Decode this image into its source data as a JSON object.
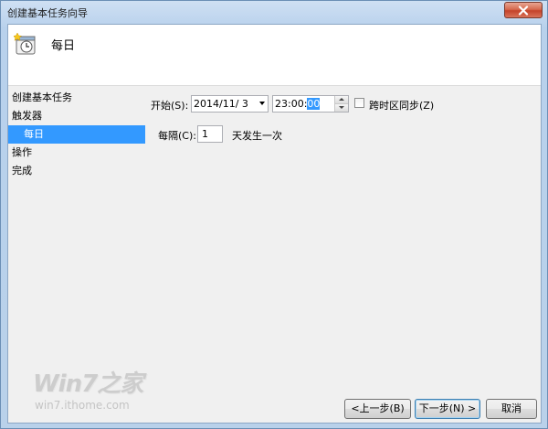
{
  "window": {
    "title": "创建基本任务向导"
  },
  "header": {
    "title": "每日",
    "icon": "clock-icon"
  },
  "steps": [
    {
      "label": "创建基本任务"
    },
    {
      "label": "触发器"
    },
    {
      "label": "每日"
    },
    {
      "label": "操作"
    },
    {
      "label": "完成"
    }
  ],
  "form": {
    "start_label": "开始(S):",
    "date_value": "2014/11/ 3",
    "time_value_prefix": "23:00:",
    "time_value_selected": "00",
    "sync_timezone_label": "跨时区同步(Z)",
    "sync_timezone_checked": false,
    "recur_label": "每隔(C):",
    "recur_value": "1",
    "recur_suffix": "天发生一次"
  },
  "watermark": {
    "brand": "Win7之家",
    "url": "win7.ithome.com"
  },
  "buttons": {
    "back": "<上一步(B)",
    "next": "下一步(N) >",
    "cancel": "取消"
  },
  "colors": {
    "selection": "#3399ff",
    "close_button": "#c4432a"
  }
}
